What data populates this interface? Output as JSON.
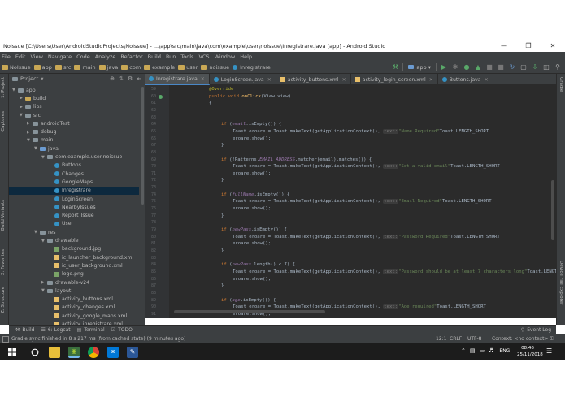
{
  "window": {
    "title": "NoIssue [C:\\Users\\User\\AndroidStudioProjects\\NoIssue] - ...\\app\\src\\main\\java\\com\\example\\user\\noissue\\Inregistrare.java [app] - Android Studio"
  },
  "menu": [
    "File",
    "Edit",
    "View",
    "Navigate",
    "Code",
    "Analyze",
    "Refactor",
    "Build",
    "Run",
    "Tools",
    "VCS",
    "Window",
    "Help"
  ],
  "breadcrumbs": [
    "NoIssue",
    "app",
    "src",
    "main",
    "java",
    "com",
    "example",
    "user",
    "noissue",
    "Inregistrare"
  ],
  "toolbar": {
    "config": "app"
  },
  "left_strip": [
    "1: Project",
    "Captures",
    "Build Variants",
    "2: Favorites",
    "Z: Structure"
  ],
  "right_strip": [
    "Gradle",
    "Device File Explorer"
  ],
  "project_panel": {
    "title": "Project",
    "items": [
      {
        "label": "app",
        "depth": 0,
        "icon": "folder"
      },
      {
        "label": "build",
        "depth": 1,
        "icon": "folder-y"
      },
      {
        "label": "libs",
        "depth": 1,
        "icon": "folder"
      },
      {
        "label": "src",
        "depth": 1,
        "icon": "folder"
      },
      {
        "label": "androidTest",
        "depth": 2,
        "icon": "folder"
      },
      {
        "label": "debug",
        "depth": 2,
        "icon": "folder"
      },
      {
        "label": "main",
        "depth": 2,
        "icon": "folder"
      },
      {
        "label": "java",
        "depth": 3,
        "icon": "folder-b"
      },
      {
        "label": "com.example.user.noissue",
        "depth": 4,
        "icon": "folder"
      },
      {
        "label": "Buttons",
        "depth": 5,
        "icon": "class"
      },
      {
        "label": "Changes",
        "depth": 5,
        "icon": "class"
      },
      {
        "label": "GoogleMaps",
        "depth": 5,
        "icon": "class"
      },
      {
        "label": "Inregistrare",
        "depth": 5,
        "icon": "class",
        "selected": true
      },
      {
        "label": "LoginScreen",
        "depth": 5,
        "icon": "class"
      },
      {
        "label": "NearbyIssues",
        "depth": 5,
        "icon": "class"
      },
      {
        "label": "Report_Issue",
        "depth": 5,
        "icon": "class"
      },
      {
        "label": "User",
        "depth": 5,
        "icon": "class"
      },
      {
        "label": "res",
        "depth": 3,
        "icon": "folder"
      },
      {
        "label": "drawable",
        "depth": 4,
        "icon": "folder"
      },
      {
        "label": "background.jpg",
        "depth": 5,
        "icon": "image"
      },
      {
        "label": "ic_launcher_background.xml",
        "depth": 5,
        "icon": "xml"
      },
      {
        "label": "ic_user_background.xml",
        "depth": 5,
        "icon": "xml"
      },
      {
        "label": "logo.png",
        "depth": 5,
        "icon": "image"
      },
      {
        "label": "drawable-v24",
        "depth": 4,
        "icon": "folder"
      },
      {
        "label": "layout",
        "depth": 4,
        "icon": "folder"
      },
      {
        "label": "activity_buttons.xml",
        "depth": 5,
        "icon": "xml"
      },
      {
        "label": "activity_changes.xml",
        "depth": 5,
        "icon": "xml"
      },
      {
        "label": "activity_google_maps.xml",
        "depth": 5,
        "icon": "xml"
      },
      {
        "label": "activity_inregistrare.xml",
        "depth": 5,
        "icon": "xml"
      }
    ]
  },
  "tabs": [
    {
      "label": "Inregistrare.java",
      "active": true
    },
    {
      "label": "LoginScreen.java"
    },
    {
      "label": "activity_buttons.xml"
    },
    {
      "label": "activity_login_screen.xml"
    },
    {
      "label": "Buttons.java"
    }
  ],
  "line_numbers": [
    "59",
    "60",
    "61",
    "62",
    "63",
    "64",
    "65",
    "66",
    "67",
    "68",
    "69",
    "70",
    "71",
    "72",
    "73",
    "74",
    "75",
    "76",
    "77",
    "78",
    "79",
    "80",
    "81",
    "82",
    "83",
    "84",
    "85",
    "86",
    "87",
    "88",
    "89",
    "90",
    "91"
  ],
  "code": {
    "override": "@Override",
    "onclick_kw": "public void ",
    "onclick_fn": "onClick",
    "onclick_rest": "(View view)",
    "brace_open": "{",
    "brace_close": "}",
    "toast_stmt": "Toast eroare = Toast.makeText(getApplicationContext(), ",
    "hint_text": "text:",
    "length_short": "Toast.LENGTH_SHORT",
    "show": "eroare.show();",
    "checks": [
      {
        "pre": "if (",
        "field": "email",
        "post": ".isEmpty()) {",
        "msg": "\"Name Required\""
      },
      {
        "pre": "if (!Patterns.",
        "field": "EMAIL_ADDRESS",
        "post": ".matcher(email).matches()) {",
        "msg": "\"Set a valid email\""
      },
      {
        "pre": "if (",
        "field": "fullName",
        "post": ".isEmpty()) {",
        "msg": "\"Email Required\""
      },
      {
        "pre": "if (",
        "field": "newPass",
        "post": ".isEmpty()) {",
        "msg": "\"Password Required\""
      },
      {
        "pre": "if (",
        "field": "newPass",
        "post": ".length() < 7) {",
        "msg": "\"Password should be at least 7 characters long\""
      },
      {
        "pre": "if (",
        "field": "age",
        "post": ".isEmpty()) {",
        "msg": "\"Age required\""
      }
    ]
  },
  "bottom_tabs": [
    "Build",
    "6: Logcat",
    "Terminal",
    "TODO"
  ],
  "event_log": "Event Log",
  "status": {
    "message": "Gradle sync finished in 8 s 217 ms (from cached state) (9 minutes ago)",
    "position": "12:1",
    "line_sep": "CRLF",
    "encoding": "UTF-8",
    "context": "Context: <no context>"
  },
  "taskbar": {
    "lang": "ENG",
    "time": "08:46",
    "date": "25/11/2018"
  }
}
